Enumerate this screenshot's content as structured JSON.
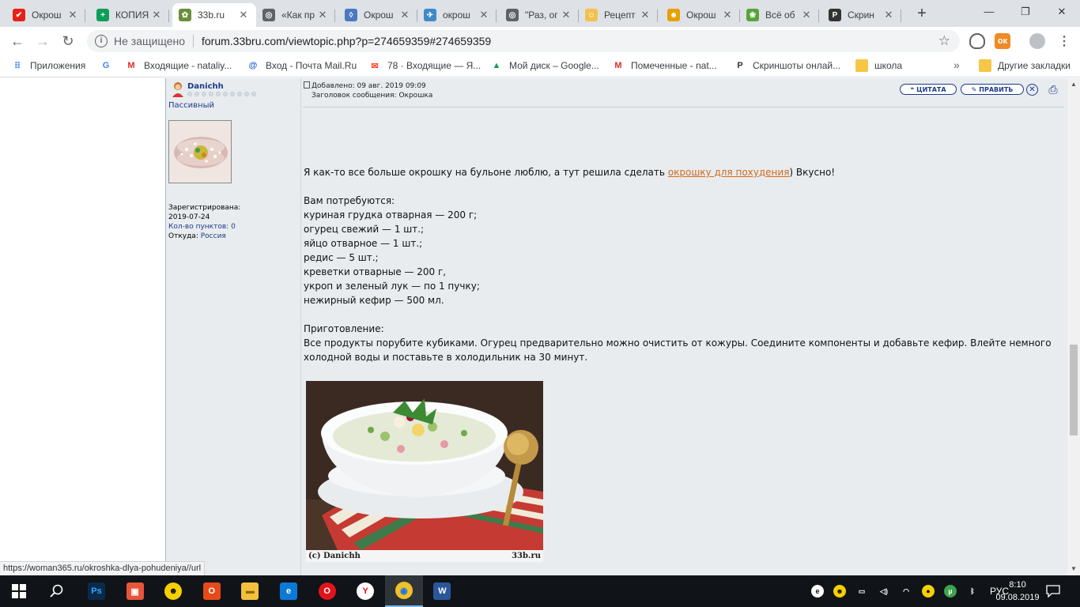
{
  "tabs": [
    {
      "title": "Окрош",
      "active": false,
      "favicon_color": "#e62117",
      "favicon_glyph": "✔"
    },
    {
      "title": "КОПИЯ",
      "active": false,
      "favicon_color": "#0f9d58",
      "favicon_glyph": "+"
    },
    {
      "title": "33b.ru",
      "active": true,
      "favicon_color": "#6a8e3a",
      "favicon_glyph": "✿"
    },
    {
      "title": "«Как пр",
      "active": false,
      "favicon_color": "#5f6368",
      "favicon_glyph": "◎"
    },
    {
      "title": "Окрош",
      "active": false,
      "favicon_color": "#4a78c2",
      "favicon_glyph": "◊"
    },
    {
      "title": "окрош",
      "active": false,
      "favicon_color": "#3e8ac9",
      "favicon_glyph": "✈"
    },
    {
      "title": "\"Раз, ог",
      "active": false,
      "favicon_color": "#5f6368",
      "favicon_glyph": "◎"
    },
    {
      "title": "Рецепт",
      "active": false,
      "favicon_color": "#f2c14e",
      "favicon_glyph": "☺"
    },
    {
      "title": "Окрош",
      "active": false,
      "favicon_color": "#e8a100",
      "favicon_glyph": "☻"
    },
    {
      "title": "Всё об",
      "active": false,
      "favicon_color": "#5aa33c",
      "favicon_glyph": "❀"
    },
    {
      "title": "Скрин",
      "active": false,
      "favicon_color": "#333333",
      "favicon_glyph": "P"
    }
  ],
  "window_controls": {
    "minimize": "—",
    "maximize": "❐",
    "close": "✕"
  },
  "tab_close_glyph": "✕",
  "new_tab_glyph": "+",
  "toolbar": {
    "back": "←",
    "forward": "→",
    "reload": "↻",
    "security_label": "Не защищено",
    "url": "forum.33bru.com/viewtopic.php?p=274659359#274659359",
    "star": "☆"
  },
  "bookmarks": [
    {
      "label": "Приложения",
      "icon": "apps-icon",
      "color": "#4285f4"
    },
    {
      "label": "",
      "icon": "google-icon",
      "color": "#4285f4"
    },
    {
      "label": "Входящие - nataliy...",
      "icon": "gmail-icon",
      "color": "#d93025"
    },
    {
      "label": "Вход - Почта Mail.Ru",
      "icon": "mailru-icon",
      "color": "#1a5fcf"
    },
    {
      "label": "78 · Входящие — Я...",
      "icon": "yandex-mail-icon",
      "color": "#fc3f1d"
    },
    {
      "label": "Мой диск – Google...",
      "icon": "drive-icon",
      "color": "#0f9d58"
    },
    {
      "label": "Помеченные - nat...",
      "icon": "gmail-icon",
      "color": "#d93025"
    },
    {
      "label": "Скриншоты онлай...",
      "icon": "prntscr-icon",
      "color": "#333333"
    },
    {
      "label": "школа",
      "icon": "folder-icon",
      "color": "#f6c646"
    }
  ],
  "bookmarks_more": "»",
  "other_bookmarks": "Другие закладки",
  "profile": {
    "username": "Danichh",
    "rank": "Пассивный",
    "registered_label": "Зарегистрирована:",
    "registered_date": "2019-07-24",
    "points_label": "Кол-во пунктов:",
    "points_value": "0",
    "from_label": "Откуда:",
    "from_value": "Россия"
  },
  "post": {
    "added": "Добавлено: 09 авг. 2019 09:09",
    "subject": "Заголовок сообщения: Окрошка",
    "quote_btn": "ЦИТАТА",
    "edit_btn": "ПРАВИТЬ",
    "delete_glyph": "✕",
    "print_glyph": "⎙",
    "intro_before": "Я как-то все больше окрошку на бульоне люблю, а тут решила сделать ",
    "intro_link": "окрошку для похудения",
    "intro_after": ") Вкусно!",
    "needs_title": "Вам потребуются:",
    "ingredients": [
      "куриная грудка отварная — 200 г;",
      "огурец свежий — 1 шт.;",
      "яйцо отварное — 1 шт.;",
      "редис — 5 шт.;",
      "креветки отварные — 200 г,",
      "укроп и зеленый лук — по 1 пучку;",
      "нежирный кефир — 500 мл."
    ],
    "prep_title": "Приготовление:",
    "prep_text": "Все продукты порубите кубиками. Огурец предварительно можно очистить от кожуры. Соедините компоненты и добавьте кефир. Влейте немного холодной воды и поставьте в холодильник на 30 минут.",
    "photo_caption_left": "(c) Danichh",
    "photo_caption_right": "33b.ru"
  },
  "status_url": "https://woman365.ru/okroshka-dlya-pohudeniya//url",
  "taskbar": {
    "apps": [
      {
        "name": "photoshop",
        "color": "#0a2a4a",
        "glyph": "Ps",
        "text_color": "#31a8ff"
      },
      {
        "name": "image-viewer",
        "color": "#e8553a",
        "glyph": "▣",
        "text_color": "#fff"
      },
      {
        "name": "cyberghost",
        "color": "#f5d000",
        "glyph": "☻",
        "text_color": "#111"
      },
      {
        "name": "office",
        "color": "#e64a19",
        "glyph": "O",
        "text_color": "#fff"
      },
      {
        "name": "explorer",
        "color": "#f3c03e",
        "glyph": "▬",
        "text_color": "#8a6a00"
      },
      {
        "name": "edge",
        "color": "#0a7ad6",
        "glyph": "e",
        "text_color": "#fff"
      },
      {
        "name": "opera",
        "color": "#e0131b",
        "glyph": "O",
        "text_color": "#fff"
      },
      {
        "name": "yandex-browser",
        "color": "#ffffff",
        "glyph": "Y",
        "text_color": "#e0131b"
      },
      {
        "name": "chrome",
        "color": "#f2c028",
        "glyph": "◉",
        "text_color": "#1a73e8"
      },
      {
        "name": "word",
        "color": "#2b579a",
        "glyph": "W",
        "text_color": "#fff"
      }
    ],
    "language": "РУС",
    "time": "8:10",
    "date": "09.08.2019"
  }
}
